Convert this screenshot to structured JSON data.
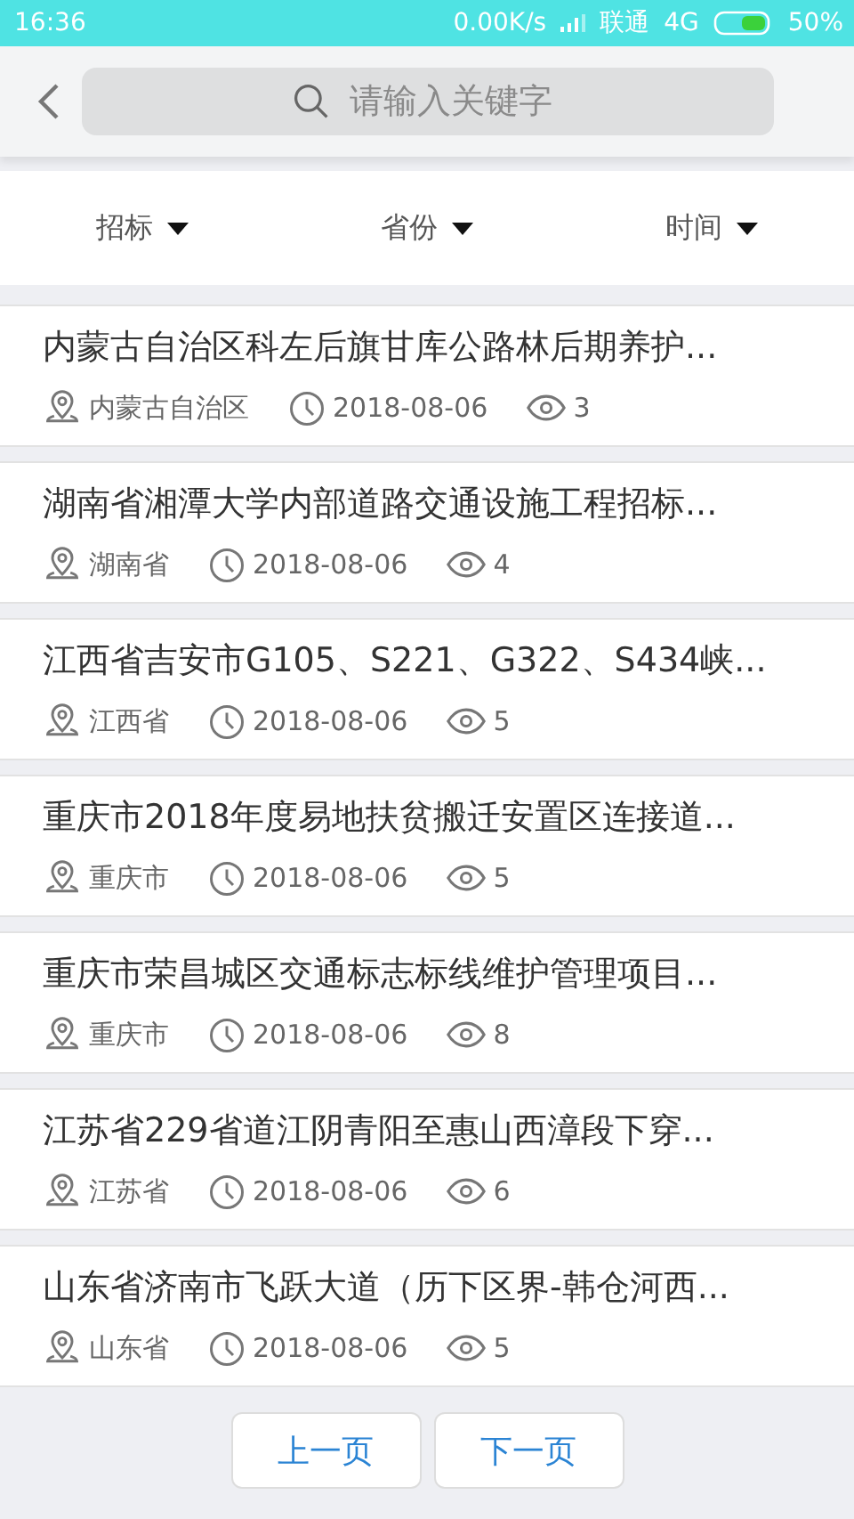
{
  "status_bar": {
    "time": "16:36",
    "speed": "0.00K/s",
    "carrier": "联通",
    "network": "4G",
    "battery": "50%"
  },
  "search": {
    "placeholder": "请输入关键字"
  },
  "filters": [
    {
      "label": "招标"
    },
    {
      "label": "省份"
    },
    {
      "label": "时间"
    }
  ],
  "items": [
    {
      "title": "内蒙古自治区科左后旗甘库公路林后期养护...",
      "region": "内蒙古自治区",
      "date": "2018-08-06",
      "views": "3"
    },
    {
      "title": "湖南省湘潭大学内部道路交通设施工程招标...",
      "region": "湖南省",
      "date": "2018-08-06",
      "views": "4"
    },
    {
      "title": "江西省吉安市G105、S221、G322、S434峡...",
      "region": "江西省",
      "date": "2018-08-06",
      "views": "5"
    },
    {
      "title": "重庆市2018年度易地扶贫搬迁安置区连接道...",
      "region": "重庆市",
      "date": "2018-08-06",
      "views": "5"
    },
    {
      "title": "重庆市荣昌城区交通标志标线维护管理项目...",
      "region": "重庆市",
      "date": "2018-08-06",
      "views": "8"
    },
    {
      "title": "江苏省229省道江阴青阳至惠山西漳段下穿...",
      "region": "江苏省",
      "date": "2018-08-06",
      "views": "6"
    },
    {
      "title": "山东省济南市飞跃大道（历下区界-韩仓河西...",
      "region": "山东省",
      "date": "2018-08-06",
      "views": "5"
    }
  ],
  "pagination": [
    "上一页",
    "下一页"
  ]
}
